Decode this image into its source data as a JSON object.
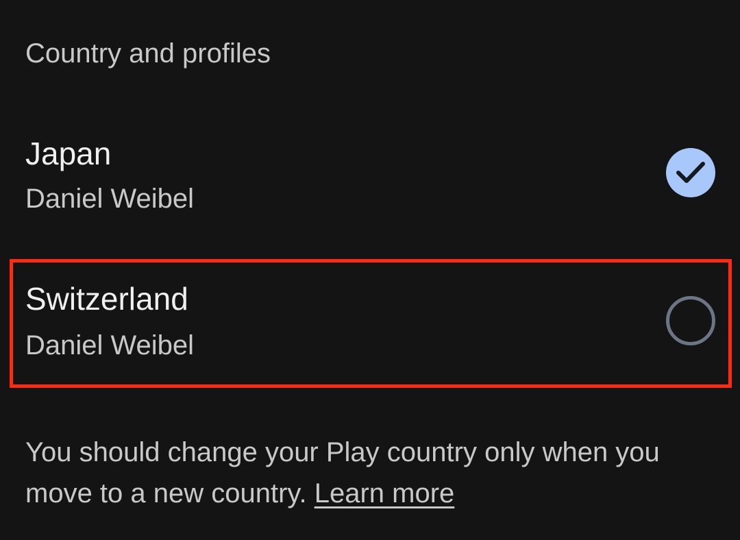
{
  "section": {
    "title": "Country and profiles"
  },
  "options": [
    {
      "country": "Japan",
      "profile": "Daniel Weibel",
      "selected": true,
      "icon": "check-circle-icon"
    },
    {
      "country": "Switzerland",
      "profile": "Daniel Weibel",
      "selected": false,
      "icon": "radio-unchecked-icon",
      "highlighted": true
    }
  ],
  "note": {
    "text": "You should change your Play country only when you move to a new country.",
    "link": "Learn more"
  },
  "colors": {
    "background": "#141414",
    "selected_accent": "#a8c7fa",
    "highlight_border": "#ff2a0f"
  }
}
